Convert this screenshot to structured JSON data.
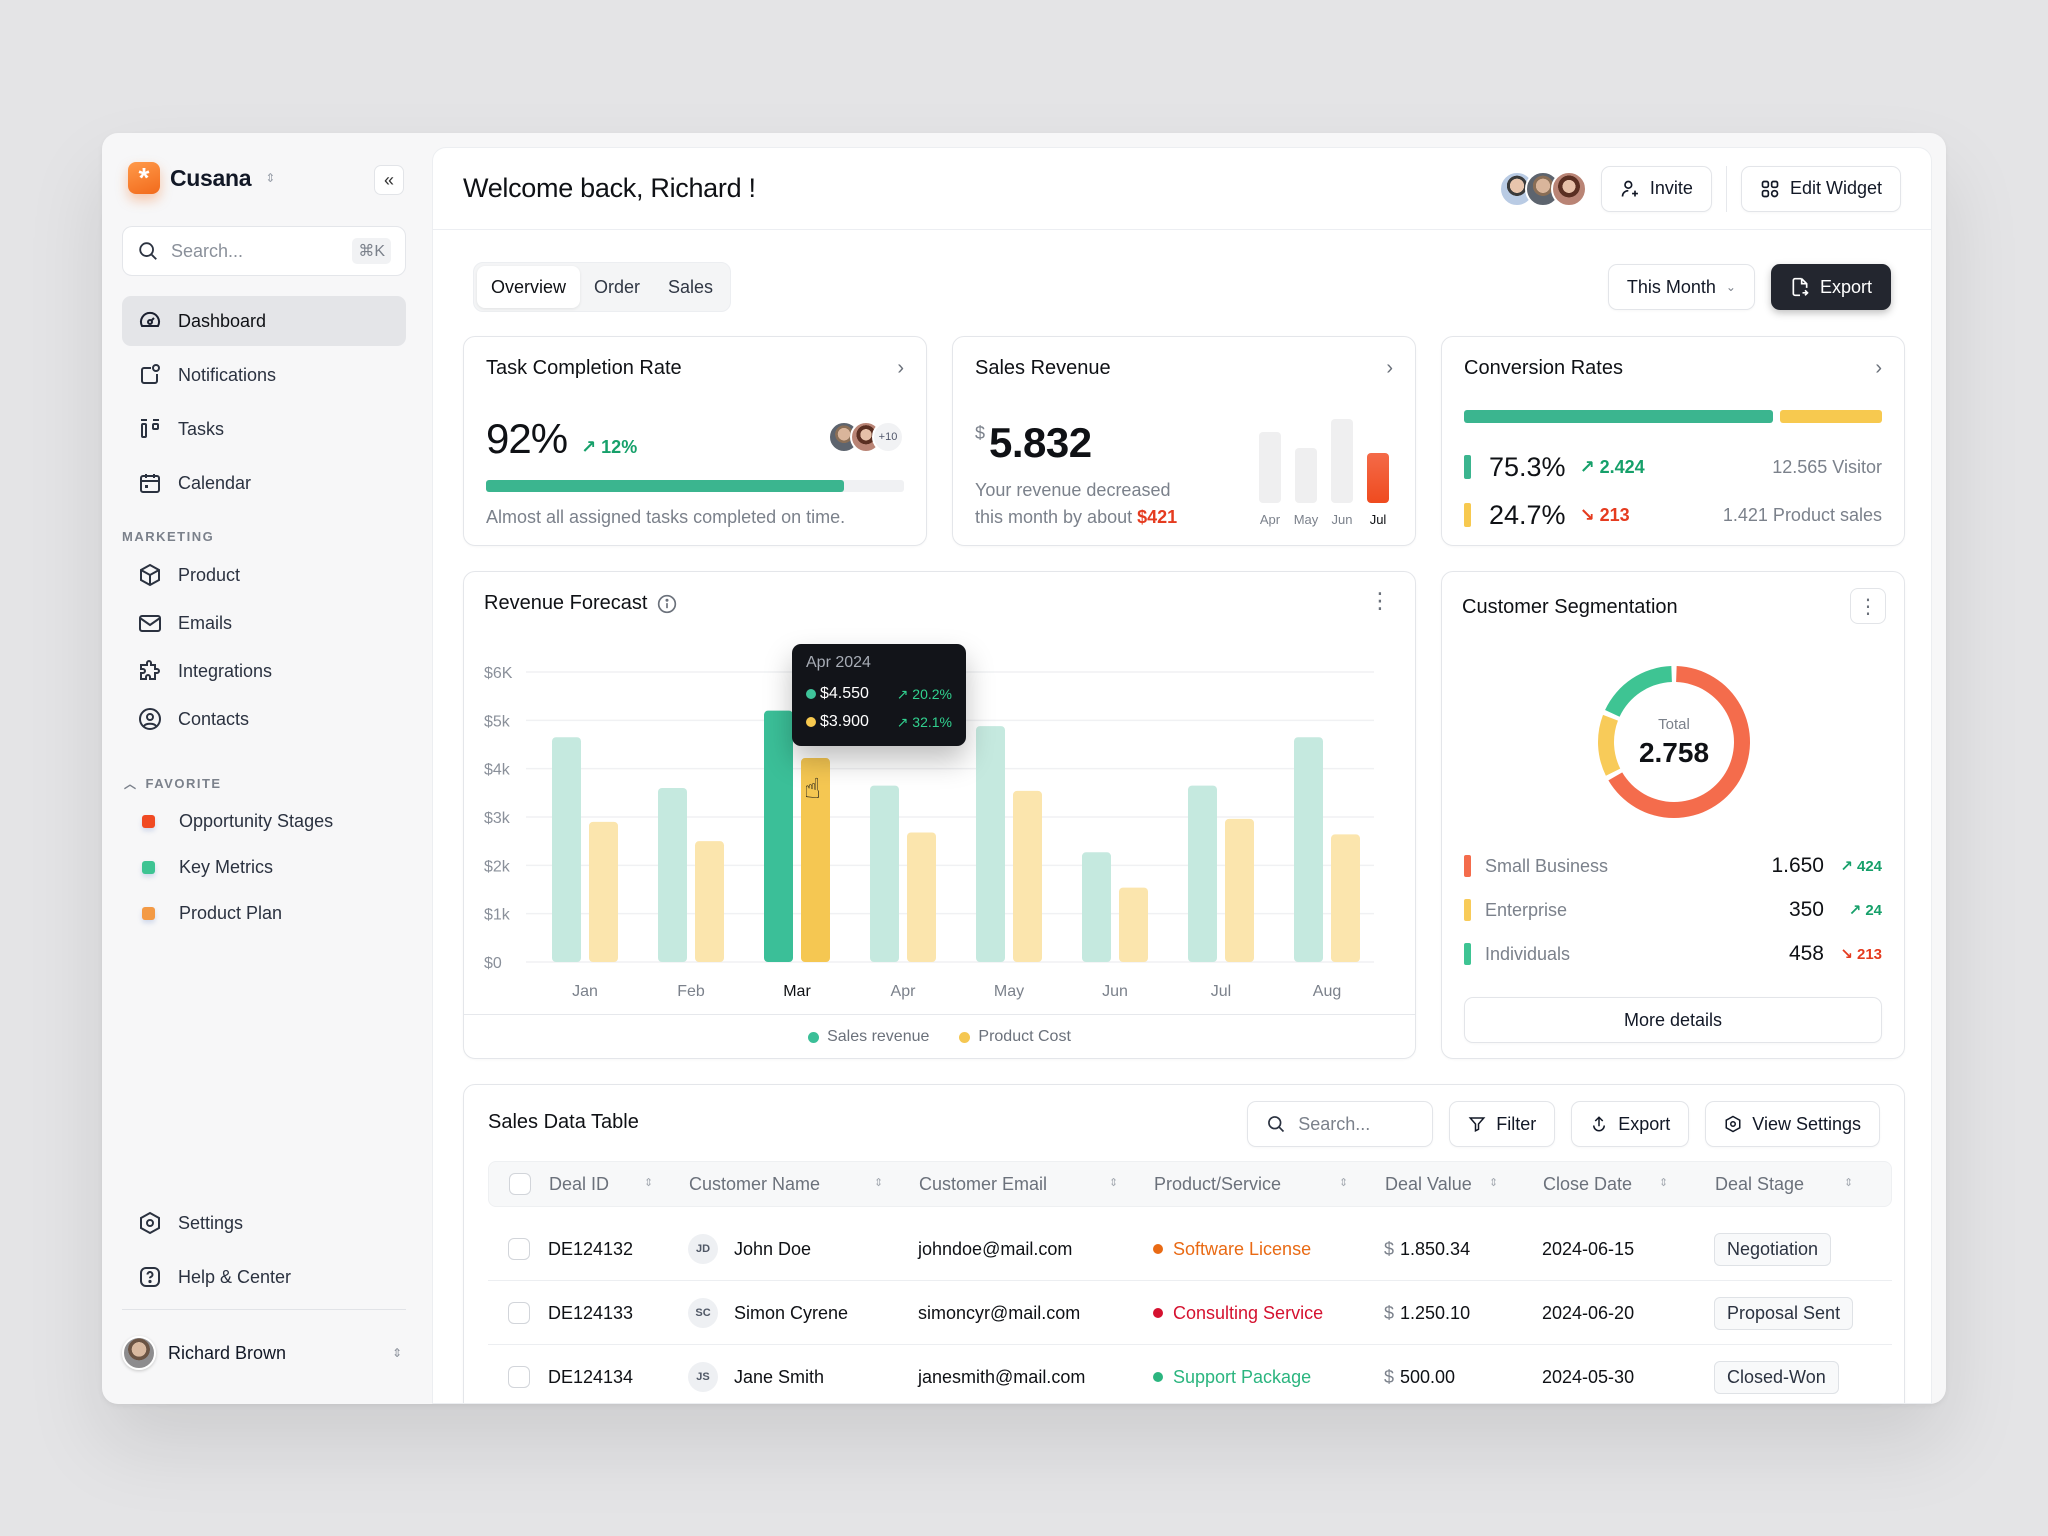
{
  "app": {
    "name": "Cusana"
  },
  "sidebar": {
    "search_placeholder": "Search...",
    "search_shortcut": "⌘K",
    "main_items": [
      {
        "label": "Dashboard",
        "icon": "dashboard-icon",
        "active": true
      },
      {
        "label": "Notifications",
        "icon": "notification-icon"
      },
      {
        "label": "Tasks",
        "icon": "tasks-icon"
      },
      {
        "label": "Calendar",
        "icon": "calendar-icon"
      }
    ],
    "marketing_label": "MARKETING",
    "marketing_items": [
      {
        "label": "Product",
        "icon": "box-icon"
      },
      {
        "label": "Emails",
        "icon": "mail-icon"
      },
      {
        "label": "Integrations",
        "icon": "puzzle-icon"
      },
      {
        "label": "Contacts",
        "icon": "user-circle-icon"
      }
    ],
    "favorite_label": "FAVORITE",
    "favorites": [
      {
        "label": "Opportunity Stages",
        "color": "#f04a23"
      },
      {
        "label": "Key Metrics",
        "color": "#3ec493"
      },
      {
        "label": "Product Plan",
        "color": "#f39a45"
      }
    ],
    "bottom_items": [
      {
        "label": "Settings",
        "icon": "settings-icon"
      },
      {
        "label": "Help & Center",
        "icon": "help-icon"
      }
    ],
    "user": {
      "name": "Richard Brown"
    }
  },
  "header": {
    "title": "Welcome back, Richard !",
    "invite_label": "Invite",
    "edit_widget_label": "Edit Widget"
  },
  "toolbar": {
    "tabs": [
      {
        "label": "Overview",
        "active": true
      },
      {
        "label": "Order"
      },
      {
        "label": "Sales"
      }
    ],
    "period_label": "This Month",
    "export_label": "Export"
  },
  "task_card": {
    "title": "Task Completion Rate",
    "value": "92%",
    "change": "12%",
    "progress_percent": 92,
    "avatars_extra": "+10",
    "caption": "Almost all assigned tasks completed on time."
  },
  "sales_card": {
    "title": "Sales Revenue",
    "currency": "$",
    "value": "5.832",
    "caption_line1": "Your revenue decreased",
    "caption_line2": "this month by about",
    "decrease": "$421",
    "mini_bars": [
      {
        "label": "Apr",
        "level": 0.84
      },
      {
        "label": "May",
        "level": 0.65
      },
      {
        "label": "Jun",
        "level": 1.0
      },
      {
        "label": "Jul",
        "level": 0.59,
        "active": true
      }
    ]
  },
  "conversion_card": {
    "title": "Conversion Rates",
    "rows": [
      {
        "percent": "75.3%",
        "share": 75.3,
        "change": "2.424",
        "trend": "up",
        "detail": "12.565 Visitor",
        "color": "#3bb58f"
      },
      {
        "percent": "24.7%",
        "share": 24.7,
        "change": "213",
        "trend": "down",
        "detail": "1.421 Product sales",
        "color": "#f7c94f"
      }
    ]
  },
  "forecast": {
    "title": "Revenue Forecast",
    "tooltip": {
      "title": "Apr 2024",
      "rows": [
        {
          "value": "$4.550",
          "change": "20.2%",
          "color": "#3ec49a"
        },
        {
          "value": "$3.900",
          "change": "32.1%",
          "color": "#f7c94f"
        }
      ]
    }
  },
  "chart_data": {
    "type": "bar",
    "title": "Revenue Forecast",
    "categories": [
      "Jan",
      "Feb",
      "Mar",
      "Apr",
      "May",
      "Jun",
      "Jul",
      "Aug"
    ],
    "highlighted_category": "Mar",
    "series": [
      {
        "name": "Sales revenue",
        "color": "#3bbf98",
        "light_color": "#c5e9df",
        "values": [
          4650,
          3600,
          5200,
          3650,
          4880,
          2270,
          3650,
          4650
        ]
      },
      {
        "name": "Product Cost",
        "color": "#f5c752",
        "light_color": "#fbe5ad",
        "values": [
          2900,
          2500,
          4220,
          2680,
          3540,
          1540,
          2960,
          2640
        ]
      }
    ],
    "yticks": [
      "$0",
      "$1k",
      "$2k",
      "$3k",
      "$4k",
      "$5k",
      "$6K"
    ],
    "ylim": [
      0,
      6000
    ],
    "xlabel": "",
    "ylabel": "",
    "grid": true,
    "legend": "bottom-center"
  },
  "segmentation": {
    "title": "Customer Segmentation",
    "total_label": "Total",
    "total": "2.758",
    "segments": [
      {
        "name": "Small Business",
        "value": "1.650",
        "amount": 1650,
        "change": "424",
        "trend": "up",
        "color": "#f46c4c"
      },
      {
        "name": "Enterprise",
        "value": "350",
        "amount": 350,
        "change": "24",
        "trend": "up",
        "color": "#f8cb59"
      },
      {
        "name": "Individuals",
        "value": "458",
        "amount": 458,
        "change": "213",
        "trend": "down",
        "color": "#3ec493"
      }
    ],
    "more_label": "More details"
  },
  "table": {
    "title": "Sales Data Table",
    "search_placeholder": "Search...",
    "filter_label": "Filter",
    "export_label": "Export",
    "view_settings_label": "View Settings",
    "columns": [
      "Deal ID",
      "Customer Name",
      "Customer Email",
      "Product/Service",
      "Deal Value",
      "Close Date",
      "Deal Stage"
    ],
    "rows": [
      {
        "id": "DE124132",
        "initials": "JD",
        "name": "John Doe",
        "email": "johndoe@mail.com",
        "product": "Software License",
        "product_color": "#e96a14",
        "currency": "$",
        "value": "1.850.34",
        "date": "2024-06-15",
        "stage": "Negotiation"
      },
      {
        "id": "DE124133",
        "initials": "SC",
        "name": "Simon Cyrene",
        "email": "simoncyr@mail.com",
        "product": "Consulting Service",
        "product_color": "#d5112f",
        "currency": "$",
        "value": "1.250.10",
        "date": "2024-06-20",
        "stage": "Proposal Sent"
      },
      {
        "id": "DE124134",
        "initials": "JS",
        "name": "Jane Smith",
        "email": "janesmith@mail.com",
        "product": "Support Package",
        "product_color": "#2bb57f",
        "currency": "$",
        "value": "500.00",
        "date": "2024-05-30",
        "stage": "Closed-Won"
      }
    ]
  }
}
